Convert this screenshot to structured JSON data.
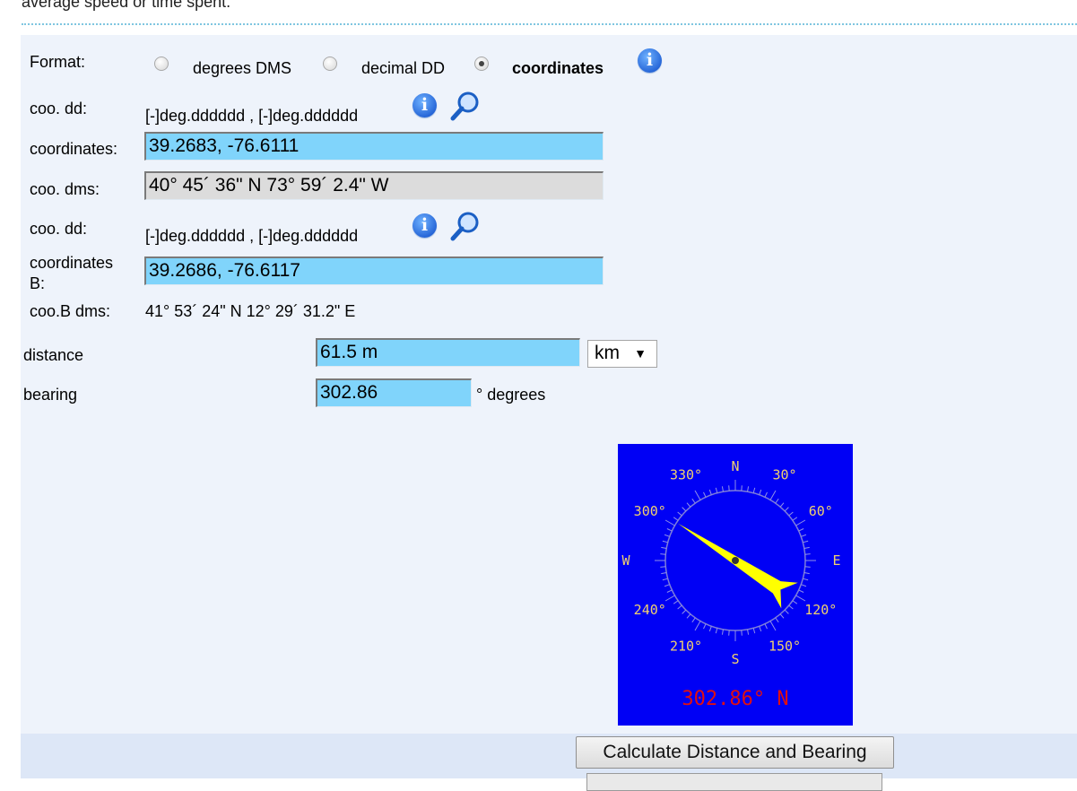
{
  "top_text": "average speed or time spent.",
  "format": {
    "label": "Format:",
    "options": [
      "degrees DMS",
      "decimal DD",
      "coordinates"
    ],
    "selected": "coordinates"
  },
  "point_a": {
    "dd_label": "coo. dd:",
    "dd_hint": "[-]deg.dddddd , [-]deg.dddddd",
    "coord_label": "coordinates:",
    "coord_value": "39.2683, -76.6111",
    "dms_label": "coo. dms:",
    "dms_value": "40° 45´ 36\" N  73° 59´ 2.4\" W"
  },
  "point_b": {
    "dd_label": "coo. dd:",
    "dd_hint": "[-]deg.dddddd , [-]deg.dddddd",
    "coord_label_line1": "coordinates",
    "coord_label_line2": "B:",
    "coord_value": "39.2686, -76.6117",
    "dms_label": "coo.B dms:",
    "dms_value": "41° 53´ 24\" N 12° 29´ 31.2\" E"
  },
  "distance": {
    "label": "distance",
    "value": "61.5 m",
    "unit": "km",
    "unit_arrow": "▼"
  },
  "bearing": {
    "label": "bearing",
    "value": "302.86",
    "unit": "° degrees"
  },
  "compass": {
    "bearing_deg": 302.86,
    "readout": "302.86° N",
    "cardinals": {
      "n": "N",
      "e": "E",
      "s": "S",
      "w": "W"
    },
    "degree_labels": [
      "30°",
      "60°",
      "120°",
      "150°",
      "210°",
      "240°",
      "300°",
      "330°"
    ],
    "colors": {
      "background": "#0000f5",
      "needle": "#ffff00",
      "text": "#f0d070",
      "readout": "#e01010"
    }
  },
  "button_label": "Calculate Distance and Bearing",
  "icons": [
    "info-icon",
    "magnifier-icon",
    "radio-icon"
  ]
}
